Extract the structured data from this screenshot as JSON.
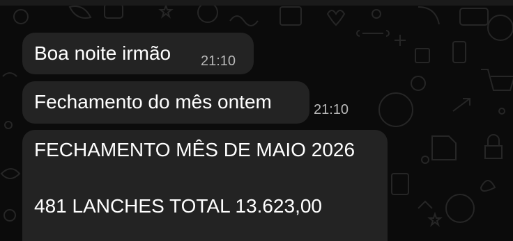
{
  "chat": {
    "messages": [
      {
        "text": "Boa noite irmão",
        "time": "21:10"
      },
      {
        "text": "Fechamento do mês ontem",
        "time": "21:10"
      },
      {
        "lines": [
          "FECHAMENTO MÊS DE MAIO 2026",
          "481 LANCHES TOTAL 13.623,00"
        ]
      }
    ]
  },
  "colors": {
    "background": "#0b0b0b",
    "bubble": "#232323",
    "text": "#ffffff",
    "timestamp": "#b8b8b8",
    "doodle": "#2a2a2a"
  }
}
